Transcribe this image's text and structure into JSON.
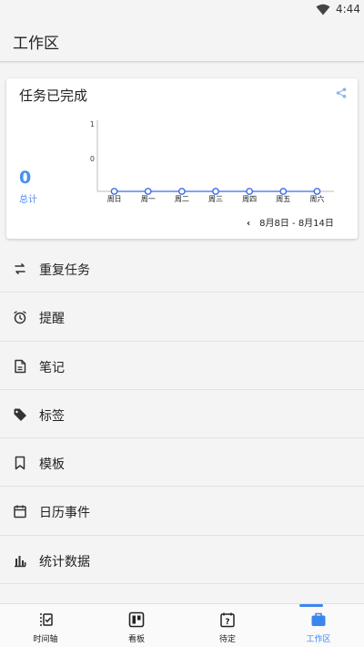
{
  "status_bar": {
    "time": "4:44",
    "wifi_icon": "wifi-icon"
  },
  "app_bar": {
    "title": "工作区"
  },
  "card": {
    "title": "任务已完成",
    "share_icon": "share-icon",
    "total_value": "0",
    "total_label": "总计",
    "date_range": "8月8日 - 8月14日",
    "prev_icon": "chevron-left-icon"
  },
  "chart_data": {
    "type": "line",
    "categories": [
      "周日",
      "周一",
      "周二",
      "周三",
      "周四",
      "周五",
      "周六"
    ],
    "values": [
      0,
      0,
      0,
      0,
      0,
      0,
      0
    ],
    "yticks": [
      "1",
      "0"
    ],
    "ylim": [
      0,
      1
    ],
    "grid": false,
    "line_color": "#3a6be8",
    "title": "任务已完成",
    "xlabel": "",
    "ylabel": ""
  },
  "menu": [
    {
      "label": "重复任务",
      "icon": "repeat-icon"
    },
    {
      "label": "提醒",
      "icon": "alarm-clock-icon"
    },
    {
      "label": "笔记",
      "icon": "note-icon"
    },
    {
      "label": "标签",
      "icon": "tag-icon"
    },
    {
      "label": "模板",
      "icon": "bookmark-icon"
    },
    {
      "label": "日历事件",
      "icon": "calendar-icon"
    },
    {
      "label": "统计数据",
      "icon": "bar-chart-icon"
    }
  ],
  "bottom_nav": [
    {
      "label": "时间轴",
      "icon": "timeline-icon",
      "active": false
    },
    {
      "label": "看板",
      "icon": "board-icon",
      "active": false
    },
    {
      "label": "待定",
      "icon": "pending-icon",
      "active": false
    },
    {
      "label": "工作区",
      "icon": "briefcase-icon",
      "active": true
    }
  ],
  "colors": {
    "accent": "#3a86ee",
    "total": "#4a8ff0"
  }
}
